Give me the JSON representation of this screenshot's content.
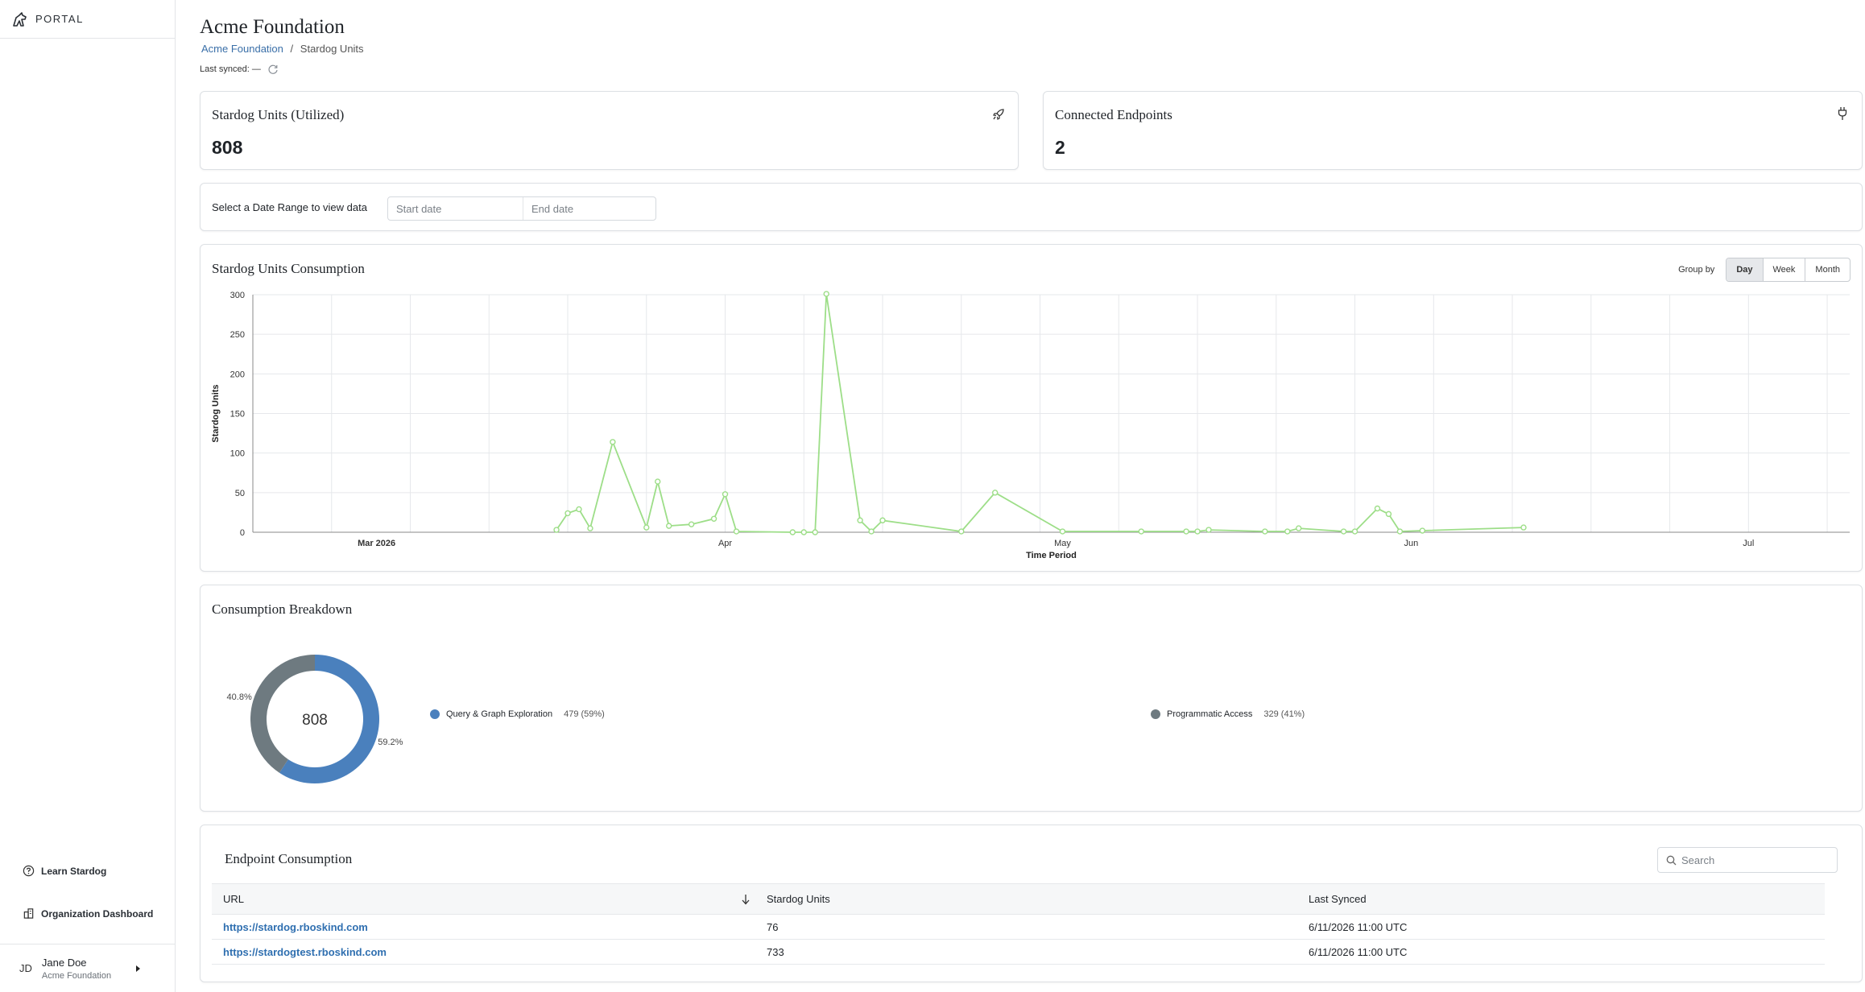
{
  "brand": {
    "name": "PORTAL"
  },
  "sidebar": {
    "learn_label": "Learn Stardog",
    "dashboard_label": "Organization Dashboard",
    "user": {
      "initials": "JD",
      "name": "Jane Doe",
      "org": "Acme Foundation"
    }
  },
  "header": {
    "title": "Acme Foundation",
    "breadcrumb": {
      "link": "Acme Foundation",
      "sep": "/",
      "current": "Stardog Units"
    },
    "sync": "Last synced: —"
  },
  "stats": [
    {
      "label": "Stardog Units (Utilized)",
      "value": "808",
      "icon": "rocket-icon"
    },
    {
      "label": "Connected Endpoints",
      "value": "2",
      "icon": "plug-icon"
    }
  ],
  "date_range": {
    "label": "Select a Date Range to view data",
    "start_placeholder": "Start date",
    "end_placeholder": "End date"
  },
  "consumption": {
    "title": "Stardog Units Consumption",
    "groupby_label": "Group by",
    "groupby_options": [
      "Day",
      "Week",
      "Month"
    ],
    "groupby_selected": "Day"
  },
  "chart_data": [
    {
      "type": "line",
      "title": "Stardog Units Consumption",
      "xlabel": "Time Period",
      "ylabel": "Stardog Units",
      "ylim": [
        0,
        300
      ],
      "yticks": [
        0,
        50,
        100,
        150,
        200,
        250,
        300
      ],
      "xtick_labels": [
        "Mar 2026",
        "Apr",
        "May",
        "Jun",
        "Jul"
      ],
      "xlim": [
        "2026-02-18",
        "2026-07-10"
      ],
      "grid": true,
      "color": "#9dde88",
      "x": [
        "2026-03-17",
        "2026-03-18",
        "2026-03-19",
        "2026-03-20",
        "2026-03-22",
        "2026-03-25",
        "2026-03-26",
        "2026-03-27",
        "2026-03-29",
        "2026-03-31",
        "2026-04-01",
        "2026-04-02",
        "2026-04-07",
        "2026-04-08",
        "2026-04-09",
        "2026-04-10",
        "2026-04-13",
        "2026-04-14",
        "2026-04-15",
        "2026-04-22",
        "2026-04-25",
        "2026-05-01",
        "2026-05-08",
        "2026-05-12",
        "2026-05-13",
        "2026-05-14",
        "2026-05-19",
        "2026-05-21",
        "2026-05-22",
        "2026-05-26",
        "2026-05-27",
        "2026-05-29",
        "2026-05-30",
        "2026-05-31",
        "2026-06-02",
        "2026-06-11"
      ],
      "y": [
        3,
        24,
        29,
        5,
        114,
        6,
        64,
        8,
        10,
        17,
        48,
        1,
        0,
        0,
        0,
        301,
        15,
        1,
        15,
        1,
        50,
        1,
        1,
        1,
        1,
        3,
        1,
        1,
        5,
        1,
        1,
        30,
        23,
        1,
        2,
        6
      ]
    },
    {
      "type": "pie",
      "title": "Consumption Breakdown",
      "center_label": "808",
      "categories": [
        "Query & Graph Exploration",
        "Programmatic Access"
      ],
      "values": [
        479,
        329
      ],
      "value_labels": [
        "479 (59%)",
        "329 (41%)"
      ],
      "slice_labels": [
        "59.2%",
        "40.8%"
      ],
      "colors": [
        "#4a80bd",
        "#6e7a80"
      ]
    }
  ],
  "breakdown": {
    "title": "Consumption Breakdown"
  },
  "endpoints": {
    "title": "Endpoint Consumption",
    "search_placeholder": "Search",
    "columns": [
      "URL",
      "Stardog Units",
      "Last Synced"
    ],
    "rows": [
      {
        "url": "https://stardog.rboskind.com",
        "units": "76",
        "synced": "6/11/2026 11:00 UTC"
      },
      {
        "url": "https://stardogtest.rboskind.com",
        "units": "733",
        "synced": "6/11/2026 11:00 UTC"
      }
    ]
  }
}
